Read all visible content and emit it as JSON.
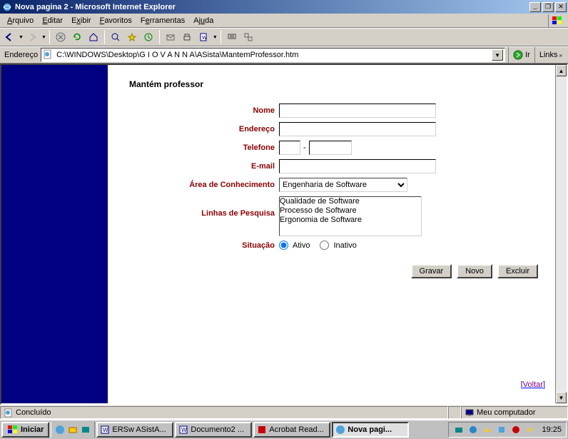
{
  "window": {
    "title": "Nova pagina 2 - Microsoft Internet Explorer"
  },
  "menu": {
    "items": [
      "Arquivo",
      "Editar",
      "Exibir",
      "Favoritos",
      "Ferramentas",
      "Ajuda"
    ]
  },
  "address": {
    "label": "Endereço",
    "value": "C:\\WINDOWS\\Desktop\\G I O V A N N A\\ASista\\MantemProfessor.htm",
    "go": "Ir",
    "links": "Links"
  },
  "page": {
    "title": "Mantém professor",
    "labels": {
      "nome": "Nome",
      "endereco": "Endereço",
      "telefone": "Telefone",
      "email": "E-mail",
      "area": "Área de Conhecimento",
      "linhas": "Linhas de Pesquisa",
      "situacao": "Situação"
    },
    "area_options": [
      "Engenharia de Software"
    ],
    "linhas_options": [
      "Qualidade de Software",
      "Processo de Software",
      "Ergonomia de Software"
    ],
    "situacao_options": {
      "ativo": "Ativo",
      "inativo": "Inativo"
    },
    "buttons": {
      "gravar": "Gravar",
      "novo": "Novo",
      "excluir": "Excluir"
    },
    "voltar": "Voltar"
  },
  "status": {
    "left": "Concluído",
    "right": "Meu computador"
  },
  "taskbar": {
    "start": "Iniciar",
    "tasks": [
      "ERSw ASistA...",
      "Documento2 ...",
      "Acrobat Read...",
      "Nova pagi..."
    ],
    "clock": "19:25"
  }
}
